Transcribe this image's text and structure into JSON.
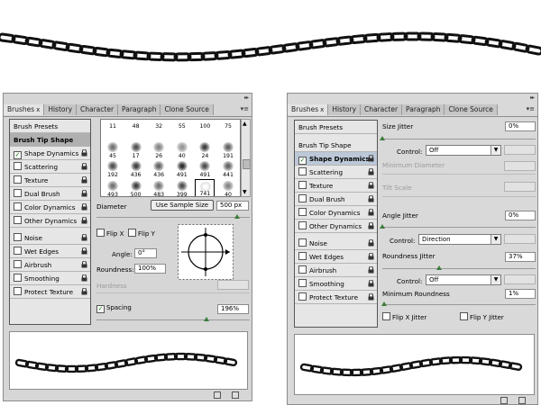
{
  "brushes_panel": {
    "tabs": [
      "Brushes",
      "History",
      "Character",
      "Paragraph",
      "Clone Source"
    ],
    "close_glyph": "x",
    "list_items": [
      "Brush Presets",
      "Brush Tip Shape",
      "Shape Dynamics",
      "Scattering",
      "Texture",
      "Dual Brush",
      "Color Dynamics",
      "Other Dynamics",
      "Noise",
      "Wet Edges",
      "Airbrush",
      "Smoothing",
      "Protect Texture"
    ],
    "brush_sizes": [
      "11",
      "48",
      "32",
      "55",
      "100",
      "75",
      "45",
      "17",
      "26",
      "40",
      "24",
      "191",
      "192",
      "436",
      "436",
      "491",
      "491",
      "441",
      "493",
      "500",
      "483",
      "399",
      "741",
      "40"
    ],
    "diameter_label": "Diameter",
    "use_sample_size": "Use Sample Size",
    "diameter_value": "500 px",
    "flip_x": "Flip X",
    "flip_y": "Flip Y",
    "angle_label": "Angle:",
    "angle_value": "0°",
    "roundness_label": "Roundness:",
    "roundness_value": "100%",
    "hardness_label": "Hardness",
    "spacing_label": "Spacing",
    "spacing_value": "196%"
  },
  "dynamics_panel": {
    "tabs": [
      "Brushes",
      "History",
      "Character",
      "Paragraph",
      "Clone Source"
    ],
    "list_items": [
      "Brush Presets",
      "Brush Tip Shape",
      "Shape Dynamics",
      "Scattering",
      "Texture",
      "Dual Brush",
      "Color Dynamics",
      "Other Dynamics",
      "Noise",
      "Wet Edges",
      "Airbrush",
      "Smoothing",
      "Protect Texture"
    ],
    "size_jitter_label": "Size Jitter",
    "size_jitter_value": "0%",
    "control_label": "Control:",
    "control_off": "Off",
    "min_diameter_label": "Minimum Diameter",
    "tilt_scale_label": "Tilt Scale",
    "angle_jitter_label": "Angle Jitter",
    "angle_jitter_value": "0%",
    "control_direction": "Direction",
    "roundness_jitter_label": "Roundness Jitter",
    "roundness_jitter_value": "37%",
    "min_roundness_label": "Minimum Roundness",
    "min_roundness_value": "1%",
    "flip_x_jitter": "Flip X Jitter",
    "flip_y_jitter": "Flip Y Jitter"
  },
  "sliders": {
    "diameter_fraction": 0.92,
    "spacing_fraction": 0.72,
    "size_jitter_fraction": 0.0,
    "angle_jitter_fraction": 0.0,
    "roundness_jitter_fraction": 0.37,
    "min_roundness_fraction": 0.01
  },
  "colors": {
    "panel_bg": "#d6d6d6",
    "accent_green": "#3a7c3a",
    "selected_row": "#b0b0b0",
    "selected_row_blue": "#bcc8d8"
  },
  "icons": [
    "chain-brush-stroke",
    "lock-icon",
    "checkmark-icon",
    "crosshair-icon",
    "new-brush-icon",
    "trash-icon",
    "panel-menu-icon"
  ]
}
